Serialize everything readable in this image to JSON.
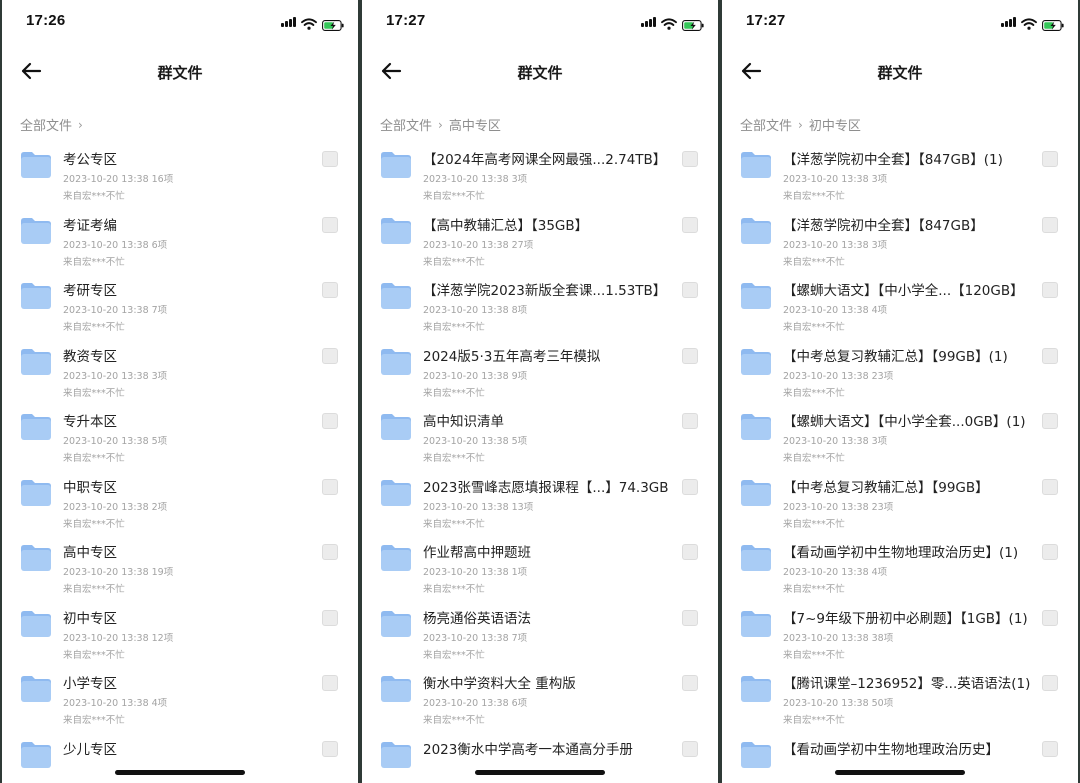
{
  "colors": {
    "folder": "#a9ccf5",
    "folder_tab": "#8fbaf0",
    "background": "#ffffff",
    "battery_fill": "#35c759"
  },
  "icons": {
    "back": "arrow-left-icon",
    "folder": "folder-icon",
    "signal": "signal-icon",
    "wifi": "wifi-icon",
    "battery": "battery-charging-icon"
  },
  "screens": [
    {
      "time": "17:26",
      "title": "群文件",
      "breadcrumb": [
        "全部文件"
      ],
      "files": [
        {
          "name": "考公专区",
          "meta": "2023-10-20 13:38 16项",
          "source": "来自宏***不忙"
        },
        {
          "name": "考证考编",
          "meta": "2023-10-20 13:38 6项",
          "source": "来自宏***不忙"
        },
        {
          "name": "考研专区",
          "meta": "2023-10-20 13:38 7项",
          "source": "来自宏***不忙"
        },
        {
          "name": "教资专区",
          "meta": "2023-10-20 13:38 3项",
          "source": "来自宏***不忙"
        },
        {
          "name": "专升本区",
          "meta": "2023-10-20 13:38 5项",
          "source": "来自宏***不忙"
        },
        {
          "name": "中职专区",
          "meta": "2023-10-20 13:38 2项",
          "source": "来自宏***不忙"
        },
        {
          "name": "高中专区",
          "meta": "2023-10-20 13:38 19项",
          "source": "来自宏***不忙"
        },
        {
          "name": "初中专区",
          "meta": "2023-10-20 13:38 12项",
          "source": "来自宏***不忙"
        },
        {
          "name": "小学专区",
          "meta": "2023-10-20 13:38 4项",
          "source": "来自宏***不忙"
        },
        {
          "name": "少儿专区",
          "meta": "",
          "source": ""
        }
      ]
    },
    {
      "time": "17:27",
      "title": "群文件",
      "breadcrumb": [
        "全部文件",
        "高中专区"
      ],
      "files": [
        {
          "name": "【2024年高考网课全网最强...2.74TB】",
          "meta": "2023-10-20 13:38 3项",
          "source": "来自宏***不忙"
        },
        {
          "name": "【高中教辅汇总】【35GB】",
          "meta": "2023-10-20 13:38 27项",
          "source": "来自宏***不忙"
        },
        {
          "name": "【洋葱学院2023新版全套课...1.53TB】",
          "meta": "2023-10-20 13:38 8项",
          "source": "来自宏***不忙"
        },
        {
          "name": "2024版5·3五年高考三年模拟",
          "meta": "2023-10-20 13:38 9项",
          "source": "来自宏***不忙"
        },
        {
          "name": "高中知识清单",
          "meta": "2023-10-20 13:38 5项",
          "source": "来自宏***不忙"
        },
        {
          "name": "2023张雪峰志愿填报课程【...】74.3GB",
          "meta": "2023-10-20 13:38 13项",
          "source": "来自宏***不忙"
        },
        {
          "name": "作业帮高中押题班",
          "meta": "2023-10-20 13:38 1项",
          "source": "来自宏***不忙"
        },
        {
          "name": "杨亮通俗英语语法",
          "meta": "2023-10-20 13:38 7项",
          "source": "来自宏***不忙"
        },
        {
          "name": "衡水中学资料大全 重构版",
          "meta": "2023-10-20 13:38 6项",
          "source": "来自宏***不忙"
        },
        {
          "name": "2023衡水中学高考一本通高分手册",
          "meta": "",
          "source": ""
        }
      ]
    },
    {
      "time": "17:27",
      "title": "群文件",
      "breadcrumb": [
        "全部文件",
        "初中专区"
      ],
      "files": [
        {
          "name": "【洋葱学院初中全套】【847GB】(1)",
          "meta": "2023-10-20 13:38 3项",
          "source": "来自宏***不忙"
        },
        {
          "name": "【洋葱学院初中全套】【847GB】",
          "meta": "2023-10-20 13:38 3项",
          "source": "来自宏***不忙"
        },
        {
          "name": "【螺蛳大语文】【中小学全...【120GB】",
          "meta": "2023-10-20 13:38 4项",
          "source": "来自宏***不忙"
        },
        {
          "name": "【中考总复习教辅汇总】【99GB】(1)",
          "meta": "2023-10-20 13:38 23项",
          "source": "来自宏***不忙"
        },
        {
          "name": "【螺蛳大语文】【中小学全套...0GB】(1)",
          "meta": "2023-10-20 13:38 3项",
          "source": "来自宏***不忙"
        },
        {
          "name": "【中考总复习教辅汇总】【99GB】",
          "meta": "2023-10-20 13:38 23项",
          "source": "来自宏***不忙"
        },
        {
          "name": "【看动画学初中生物地理政治历史】(1)",
          "meta": "2023-10-20 13:38 4项",
          "source": "来自宏***不忙"
        },
        {
          "name": "【7~9年级下册初中必刷题】【1GB】(1)",
          "meta": "2023-10-20 13:38 38项",
          "source": "来自宏***不忙"
        },
        {
          "name": "【腾讯课堂–1236952】零...英语语法(1)",
          "meta": "2023-10-20 13:38 50项",
          "source": "来自宏***不忙"
        },
        {
          "name": "【看动画学初中生物地理政治历史】",
          "meta": "",
          "source": ""
        }
      ]
    }
  ]
}
